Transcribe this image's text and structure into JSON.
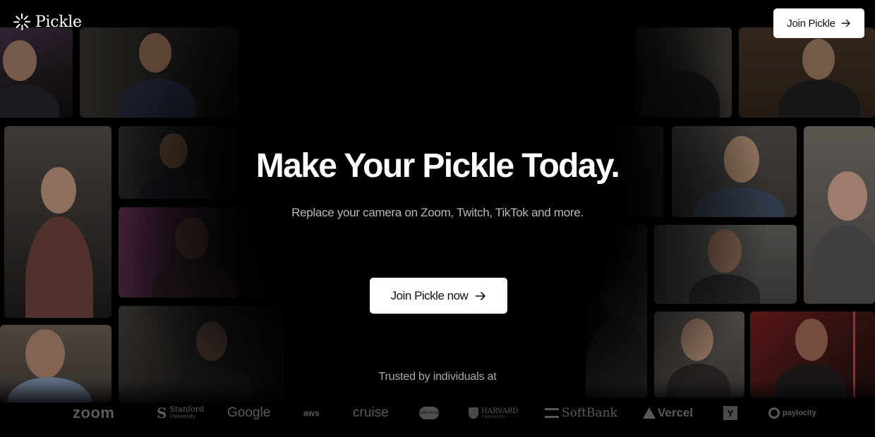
{
  "brand": {
    "name": "Pickle"
  },
  "header": {
    "cta_label": "Join Pickle",
    "cta_icon": "arrow-right-icon"
  },
  "hero": {
    "title": "Make Your Pickle Today.",
    "subtitle": "Replace your camera on Zoom, Twitch, TikTok and more.",
    "cta_label": "Join Pickle now",
    "cta_icon": "arrow-right-icon"
  },
  "trusted": {
    "label": "Trusted by individuals at",
    "logos": {
      "zoom": "zoom",
      "stanford": "Stanford",
      "stanford_sub": "University",
      "google": "Google",
      "aws": "aws",
      "cruise": "cruise",
      "salesforce": "salesforce",
      "harvard": "HARVARD",
      "harvard_sub": "UNIVERSITY",
      "softbank": "SoftBank",
      "vercel": "Vercel",
      "ycombinator": "Y",
      "paylocity": "paylocity"
    }
  },
  "colors": {
    "background": "#000000",
    "button_bg": "#ffffff",
    "button_text": "#111111",
    "muted_text": "#b9b9b9",
    "logo_gray": "#5a5a5a"
  }
}
